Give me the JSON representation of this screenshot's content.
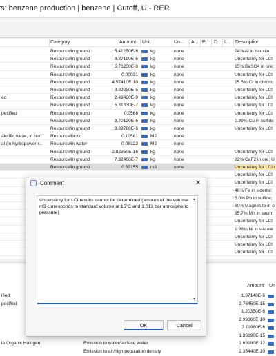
{
  "window": {
    "title": "ts: benzene production | benzene | Cutoff, U - RER"
  },
  "table": {
    "columns": [
      "Category",
      "Amount",
      "Unit",
      "Un...",
      "A...",
      "P...",
      "D...",
      "L...",
      "Description"
    ],
    "rows": [
      {
        "name": "",
        "category": "Resource/in ground",
        "amount": "5.41250E-6",
        "unit": "kg",
        "uncertainty": "none",
        "description": "24% Al in bauxite;"
      },
      {
        "name": "",
        "category": "Resource/in ground",
        "amount": "8.87190E-6",
        "unit": "kg",
        "uncertainty": "none",
        "description": "Uncertainty for LCI"
      },
      {
        "name": "",
        "category": "Resource/in ground",
        "amount": "5.78230E-8",
        "unit": "kg",
        "uncertainty": "none",
        "description": "15% BaSO4 in ore;"
      },
      {
        "name": "",
        "category": "Resource/in ground",
        "amount": "0.00031",
        "unit": "kg",
        "uncertainty": "none",
        "description": "Uncertainty for LCI"
      },
      {
        "name": "",
        "category": "Resource/in ground",
        "amount": "4.57410E-10",
        "unit": "kg",
        "uncertainty": "none",
        "description": "25.5% Cr in chromi"
      },
      {
        "name": "",
        "category": "Resource/in ground",
        "amount": "8.89250E-5",
        "unit": "kg",
        "uncertainty": "none",
        "description": "Uncertainty for LCI"
      },
      {
        "name": "ed",
        "category": "Resource/in ground",
        "amount": "2.49420E-9",
        "unit": "kg",
        "uncertainty": "none",
        "description": "Uncertainty for LCI"
      },
      {
        "name": "",
        "category": "Resource/in ground",
        "amount": "5.31330E-7",
        "unit": "kg",
        "uncertainty": "none",
        "description": "Uncertainty for LCI"
      },
      {
        "name": "pecified",
        "category": "Resource/in ground",
        "amount": "0.0568",
        "unit": "kg",
        "uncertainty": "none",
        "description": "Uncertainty for LCI"
      },
      {
        "name": "",
        "category": "Resource/in ground",
        "amount": "3.70120E-6",
        "unit": "kg",
        "uncertainty": "none",
        "description": "0.99% Cu in sulfide"
      },
      {
        "name": "",
        "category": "Resource/in ground",
        "amount": "3.89780E-6",
        "unit": "kg",
        "uncertainty": "none",
        "description": "Uncertainty for LCI"
      },
      {
        "name": "alorific value, in bio...",
        "category": "Resource/biotic",
        "amount": "0.10581",
        "unit": "MJ",
        "uncertainty": "none",
        "description": ""
      },
      {
        "name": "al (in hydropower r...",
        "category": "Resource/in water",
        "amount": "0.08322",
        "unit": "MJ",
        "uncertainty": "none",
        "description": ""
      },
      {
        "name": "",
        "category": "Resource/in ground",
        "amount": "2.82350E-16",
        "unit": "kg",
        "uncertainty": "none",
        "description": "Uncertainty for LCI"
      },
      {
        "name": "",
        "category": "Resource/in ground",
        "amount": "7.32460E-7",
        "unit": "kg",
        "uncertainty": "none",
        "description": "92% CaF2 in ore; U"
      },
      {
        "name": "",
        "category": "Resource/in ground",
        "amount": "0.63155",
        "unit": "m3",
        "uncertainty": "none",
        "description": "Uncertainty for LCI r"
      },
      {
        "name": "",
        "category": "",
        "amount": "",
        "unit": "",
        "uncertainty": "",
        "description": "Uncertainty for LCI"
      },
      {
        "name": "",
        "category": "",
        "amount": "",
        "unit": "",
        "uncertainty": "",
        "description": "Uncertainty for LCI"
      },
      {
        "name": "",
        "category": "",
        "amount": "",
        "unit": "",
        "uncertainty": "",
        "description": "46% Fe in siderite;"
      },
      {
        "name": "",
        "category": "",
        "amount": "",
        "unit": "",
        "uncertainty": "",
        "description": "5.0% Pb in sulfide;"
      },
      {
        "name": "",
        "category": "",
        "amount": "",
        "unit": "",
        "uncertainty": "",
        "description": "60% Magnesite in o"
      },
      {
        "name": "",
        "category": "",
        "amount": "",
        "unit": "",
        "uncertainty": "",
        "description": "35.7% Mn in sedim"
      },
      {
        "name": "",
        "category": "",
        "amount": "",
        "unit": "",
        "uncertainty": "",
        "description": "Uncertainty for LCI"
      },
      {
        "name": "",
        "category": "",
        "amount": "",
        "unit": "",
        "uncertainty": "",
        "description": "1.98% Ni in silicate"
      },
      {
        "name": "",
        "category": "",
        "amount": "",
        "unit": "",
        "uncertainty": "",
        "description": "Uncertainty for LCI"
      },
      {
        "name": "",
        "category": "",
        "amount": "",
        "unit": "",
        "uncertainty": "",
        "description": "Uncertainty for LCI"
      },
      {
        "name": "",
        "category": "",
        "amount": "",
        "unit": "",
        "uncertainty": "",
        "description": "Uncertainty for LCI"
      }
    ],
    "selected_row": 15
  },
  "bottom_table": {
    "columns": [
      "Amount",
      "Un"
    ],
    "rows": [
      {
        "name": "ified",
        "category": "",
        "amount": "1.67140E-6"
      },
      {
        "name": "pecified",
        "category": "",
        "amount": "2.76450E-15"
      },
      {
        "name": "",
        "category": "",
        "amount": "1.20350E-6"
      },
      {
        "name": "",
        "category": "",
        "amount": "2.99360E-10"
      },
      {
        "name": "",
        "category": "",
        "amount": "3.11960E-6"
      },
      {
        "name": "",
        "category": "",
        "amount": "1.85690E-15"
      },
      {
        "name": "le Organic Halogen",
        "category": "Emission to water/surface water",
        "amount": "1.69190E-12"
      },
      {
        "name": "",
        "category": "Emission to air/high population density",
        "amount": "2.35440E-10"
      }
    ]
  },
  "dialog": {
    "title": "Comment",
    "close_label": "✕",
    "comment_text": "Uncertainty for LCI results cannot be determined (amount of the volume m3 corresponds to standard volume at 15°C and 1.013 bar atmospheric pressure)",
    "ok_label": "OK",
    "cancel_label": "Cancel"
  },
  "colors": {
    "selected_row": "#dcdcdc",
    "selected_description": "#fbe7a3",
    "accent": "#2a5ea8",
    "unit_icon": "#3a6db5"
  }
}
